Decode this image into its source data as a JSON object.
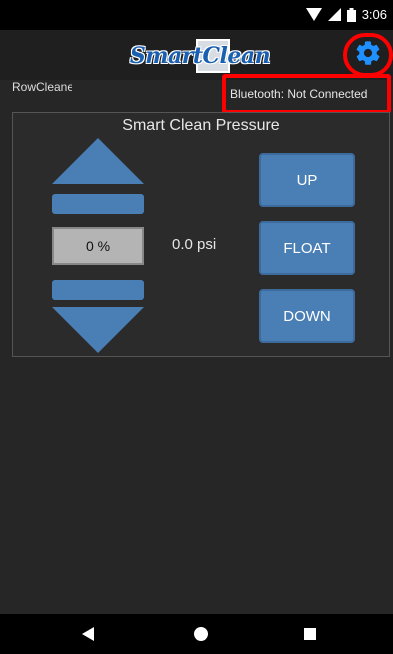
{
  "status_bar": {
    "time": "3:06"
  },
  "app_bar": {
    "logo_text": "SmartClean"
  },
  "app_name": "RowCleanerApp",
  "bluetooth_status": "Bluetooth: Not Connected",
  "panel": {
    "title": "Smart Clean Pressure",
    "percent_value": "0 %",
    "pressure_value": "0.0 psi"
  },
  "buttons": {
    "up": "UP",
    "float": "FLOAT",
    "down": "DOWN"
  },
  "colors": {
    "accent": "#4a7fb5",
    "highlight": "#ff0000",
    "settings_icon": "#1e90ff"
  },
  "icons": [
    "wifi-icon",
    "signal-icon",
    "battery-icon",
    "settings-gear-icon",
    "arrow-up-icon",
    "arrow-down-icon",
    "nav-back-icon",
    "nav-home-icon",
    "nav-recent-icon"
  ]
}
